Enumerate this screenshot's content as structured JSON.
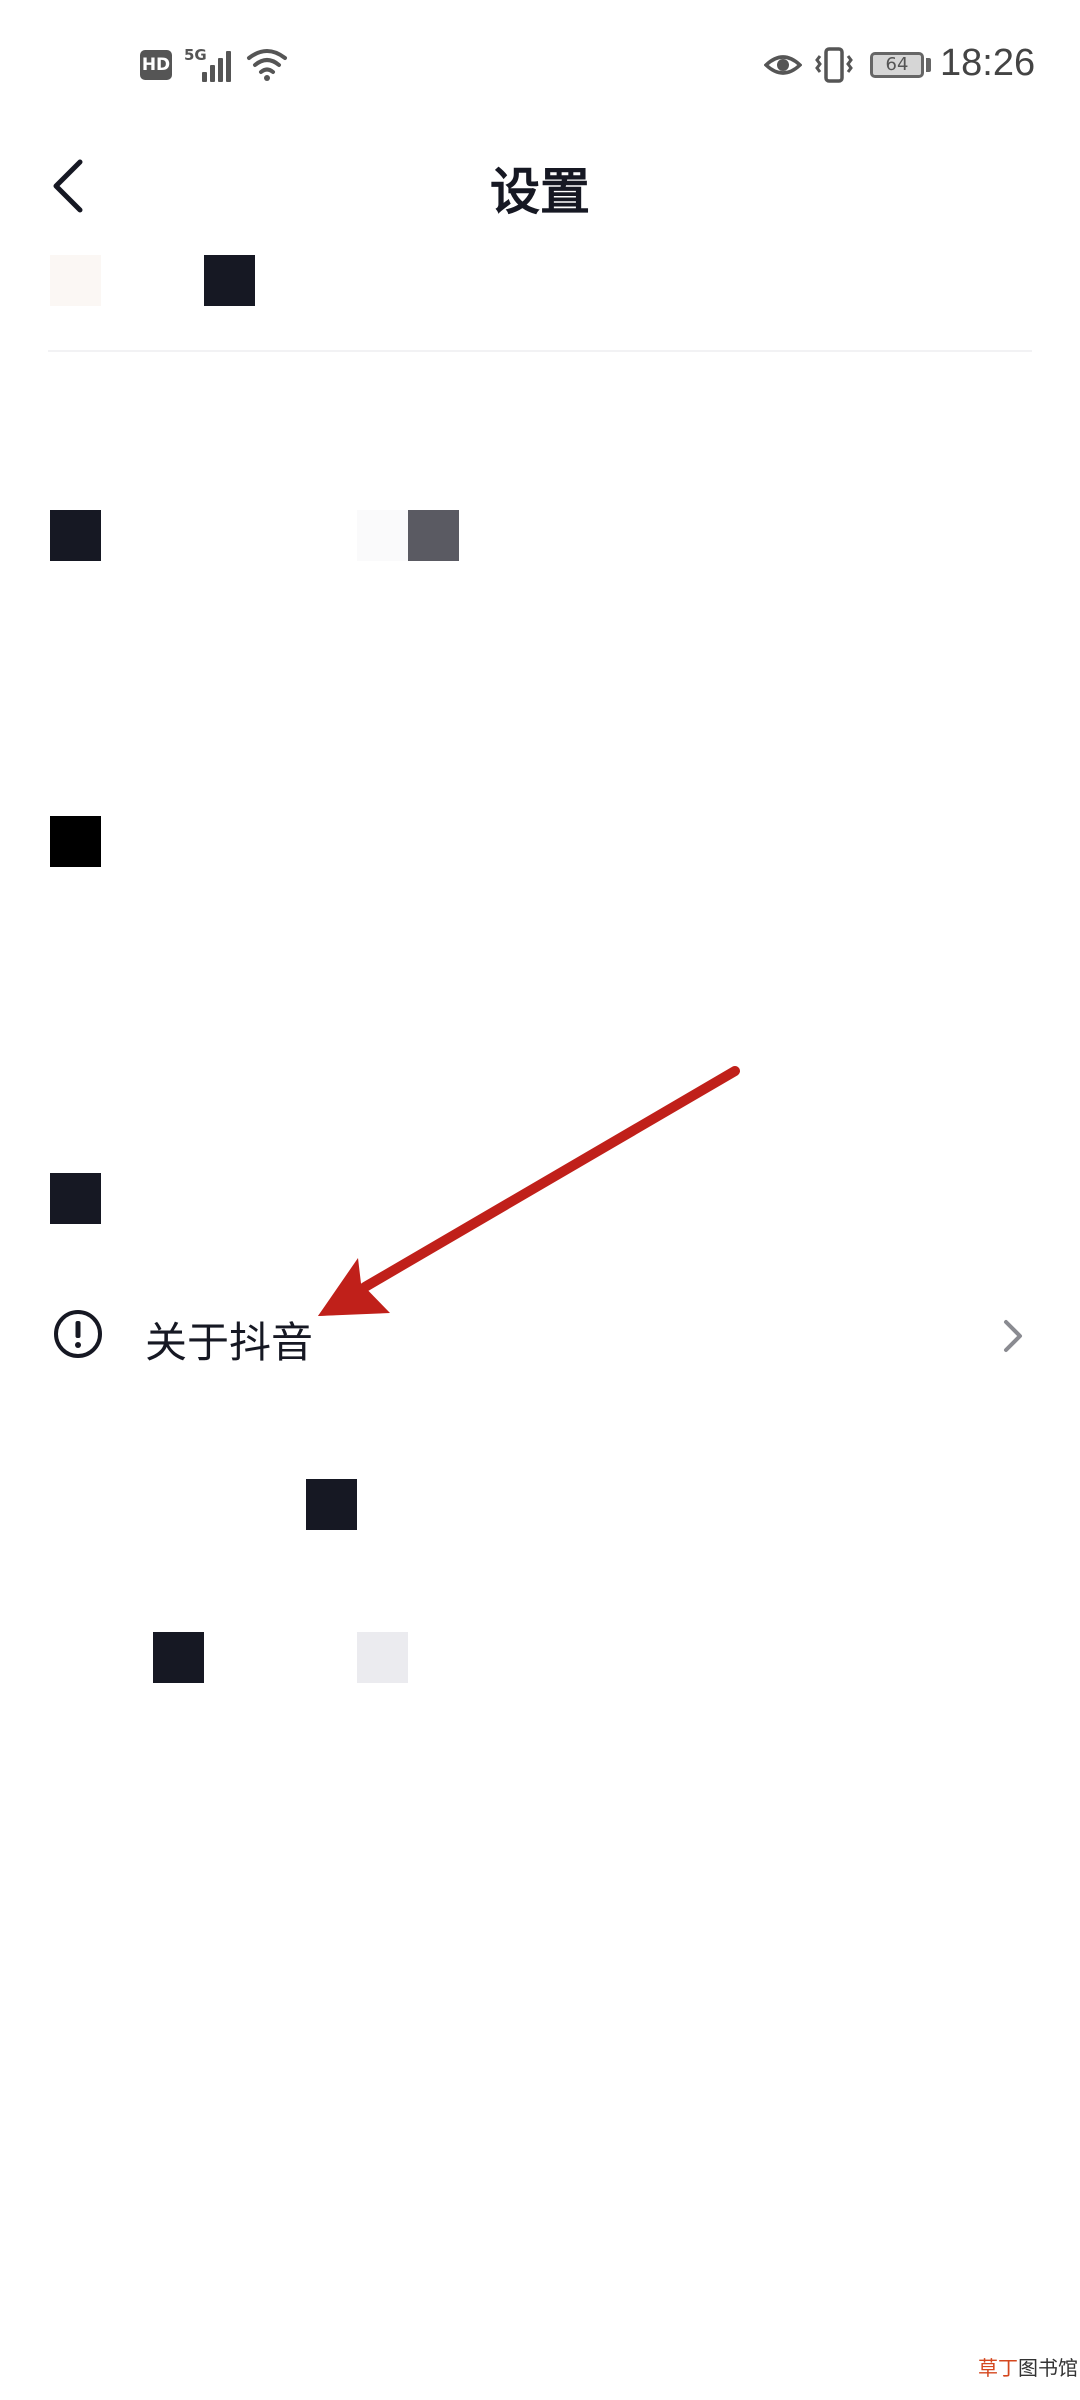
{
  "status_bar": {
    "hd": "HD",
    "network": "5G",
    "battery": "64",
    "time": "18:26"
  },
  "header": {
    "title": "设置"
  },
  "settings": {
    "about_label": "关于抖音"
  },
  "icons": {
    "back": "back-arrow-icon",
    "about": "info-circle-icon",
    "chevron": "chevron-right-icon"
  },
  "colors": {
    "text": "#161823",
    "arrow": "#c0201a"
  },
  "watermark": {
    "brand_red": "草丁",
    "brand_rest": "图书馆"
  }
}
